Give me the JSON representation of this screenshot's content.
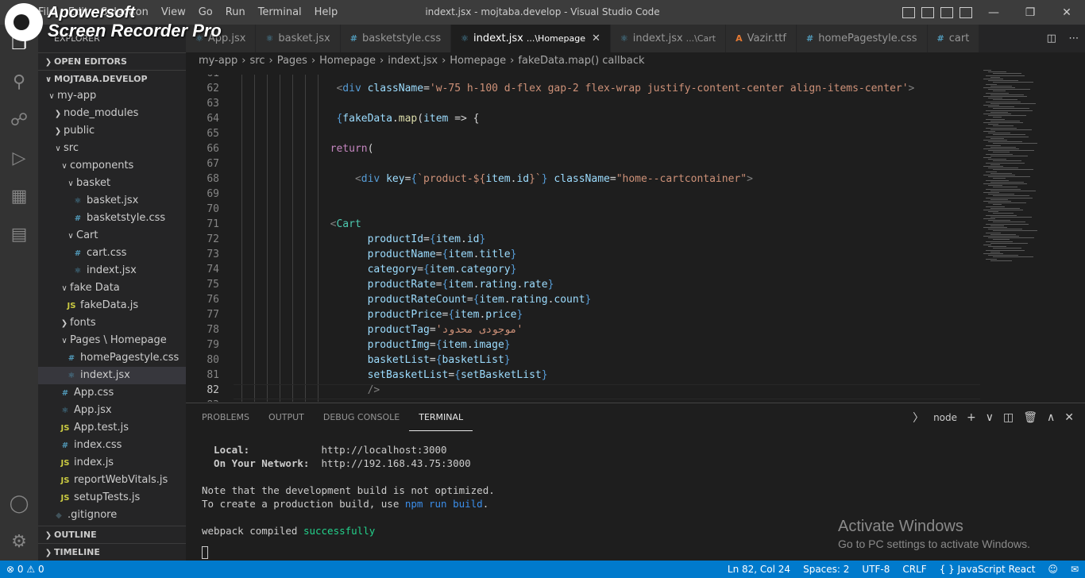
{
  "window": {
    "title": "indext.jsx - mojtaba.develop - Visual Studio Code"
  },
  "menu": [
    "File",
    "Edit",
    "Selection",
    "View",
    "Go",
    "Run",
    "Terminal",
    "Help"
  ],
  "watermark": {
    "line1": "Apowersoft",
    "line2": "Screen Recorder Pro"
  },
  "sidebar": {
    "title": "EXPLORER",
    "open_editors": "OPEN EDITORS",
    "root": "MOJTABA.DEVELOP",
    "items": [
      {
        "label": "my-app",
        "depth": 1,
        "type": "folder-open"
      },
      {
        "label": "node_modules",
        "depth": 2,
        "type": "folder"
      },
      {
        "label": "public",
        "depth": 2,
        "type": "folder"
      },
      {
        "label": "src",
        "depth": 2,
        "type": "folder-open"
      },
      {
        "label": "components",
        "depth": 3,
        "type": "folder-open"
      },
      {
        "label": "basket",
        "depth": 4,
        "type": "folder-open"
      },
      {
        "label": "basket.jsx",
        "depth": 5,
        "type": "react"
      },
      {
        "label": "basketstyle.css",
        "depth": 5,
        "type": "css"
      },
      {
        "label": "Cart",
        "depth": 4,
        "type": "folder-open"
      },
      {
        "label": "cart.css",
        "depth": 5,
        "type": "css"
      },
      {
        "label": "indext.jsx",
        "depth": 5,
        "type": "react"
      },
      {
        "label": "fake Data",
        "depth": 3,
        "type": "folder-open"
      },
      {
        "label": "fakeData.js",
        "depth": 4,
        "type": "js"
      },
      {
        "label": "fonts",
        "depth": 3,
        "type": "folder"
      },
      {
        "label": "Pages \\ Homepage",
        "depth": 3,
        "type": "folder-open"
      },
      {
        "label": "homePagestyle.css",
        "depth": 4,
        "type": "css"
      },
      {
        "label": "indext.jsx",
        "depth": 4,
        "type": "react",
        "selected": true
      },
      {
        "label": "App.css",
        "depth": 3,
        "type": "css"
      },
      {
        "label": "App.jsx",
        "depth": 3,
        "type": "react"
      },
      {
        "label": "App.test.js",
        "depth": 3,
        "type": "js"
      },
      {
        "label": "index.css",
        "depth": 3,
        "type": "css"
      },
      {
        "label": "index.js",
        "depth": 3,
        "type": "js"
      },
      {
        "label": "reportWebVitals.js",
        "depth": 3,
        "type": "js"
      },
      {
        "label": "setupTests.js",
        "depth": 3,
        "type": "js"
      },
      {
        "label": ".gitignore",
        "depth": 2,
        "type": "git"
      }
    ],
    "outline": "OUTLINE",
    "timeline": "TIMELINE"
  },
  "tabs": [
    {
      "label": "App.jsx",
      "icon": "react",
      "hint": ""
    },
    {
      "label": "basket.jsx",
      "icon": "react",
      "hint": ""
    },
    {
      "label": "basketstyle.css",
      "icon": "css",
      "hint": ""
    },
    {
      "label": "indext.jsx",
      "icon": "react",
      "hint": "...\\Homepage",
      "active": true
    },
    {
      "label": "indext.jsx",
      "icon": "react",
      "hint": "...\\Cart"
    },
    {
      "label": "Vazir.ttf",
      "icon": "font",
      "hint": ""
    },
    {
      "label": "homePagestyle.css",
      "icon": "css",
      "hint": ""
    },
    {
      "label": "cart",
      "icon": "css",
      "hint": ""
    }
  ],
  "breadcrumb": [
    "my-app",
    "src",
    "Pages",
    "Homepage",
    "indext.jsx",
    "Homepage",
    "fakeData.map() callback"
  ],
  "code_lines": [
    {
      "n": "61",
      "indent": 0,
      "segs": [
        [
          "",
          "#d4d4d4"
        ]
      ]
    },
    {
      "n": "62",
      "indent": 14,
      "segs": [
        [
          "<",
          "#808080"
        ],
        [
          "div",
          "#569cd6"
        ],
        [
          " ",
          "#d4d4d4"
        ],
        [
          "className",
          "#9cdcfe"
        ],
        [
          "=",
          "#d4d4d4"
        ],
        [
          "'w-75 h-100 d-flex gap-2 flex-wrap justify-content-center align-items-center'",
          "#ce9178"
        ],
        [
          ">",
          "#808080"
        ]
      ]
    },
    {
      "n": "63",
      "indent": 0,
      "segs": [
        [
          "",
          "#d4d4d4"
        ]
      ]
    },
    {
      "n": "64",
      "indent": 14,
      "segs": [
        [
          "{",
          "#569cd6"
        ],
        [
          "fakeData",
          "#9cdcfe"
        ],
        [
          ".",
          "#d4d4d4"
        ],
        [
          "map",
          "#dcdcaa"
        ],
        [
          "(",
          "#d4d4d4"
        ],
        [
          "item",
          "#9cdcfe"
        ],
        [
          " => {",
          "#d4d4d4"
        ]
      ]
    },
    {
      "n": "65",
      "indent": 0,
      "segs": [
        [
          "",
          "#d4d4d4"
        ]
      ]
    },
    {
      "n": "66",
      "indent": 13,
      "segs": [
        [
          "return",
          "#c586c0"
        ],
        [
          "(",
          "#d4d4d4"
        ]
      ]
    },
    {
      "n": "67",
      "indent": 0,
      "segs": [
        [
          "",
          "#d4d4d4"
        ]
      ]
    },
    {
      "n": "68",
      "indent": 17,
      "segs": [
        [
          "<",
          "#808080"
        ],
        [
          "div",
          "#569cd6"
        ],
        [
          " ",
          "#d4d4d4"
        ],
        [
          "key",
          "#9cdcfe"
        ],
        [
          "=",
          "#d4d4d4"
        ],
        [
          "{",
          "#569cd6"
        ],
        [
          "`product-${",
          "#ce9178"
        ],
        [
          "item",
          "#9cdcfe"
        ],
        [
          ".",
          "#d4d4d4"
        ],
        [
          "id",
          "#9cdcfe"
        ],
        [
          "}`",
          "#ce9178"
        ],
        [
          "}",
          "#569cd6"
        ],
        [
          " ",
          "#d4d4d4"
        ],
        [
          "className",
          "#9cdcfe"
        ],
        [
          "=",
          "#d4d4d4"
        ],
        [
          "\"home--cartcontainer\"",
          "#ce9178"
        ],
        [
          ">",
          "#808080"
        ]
      ]
    },
    {
      "n": "69",
      "indent": 0,
      "segs": [
        [
          "",
          "#d4d4d4"
        ]
      ]
    },
    {
      "n": "70",
      "indent": 0,
      "segs": [
        [
          "",
          "#d4d4d4"
        ]
      ]
    },
    {
      "n": "71",
      "indent": 13,
      "segs": [
        [
          "<",
          "#808080"
        ],
        [
          "Cart",
          "#4ec9b0"
        ]
      ]
    },
    {
      "n": "72",
      "indent": 19,
      "segs": [
        [
          "productId",
          "#9cdcfe"
        ],
        [
          "=",
          "#d4d4d4"
        ],
        [
          "{",
          "#569cd6"
        ],
        [
          "item",
          "#9cdcfe"
        ],
        [
          ".",
          "#d4d4d4"
        ],
        [
          "id",
          "#9cdcfe"
        ],
        [
          "}",
          "#569cd6"
        ]
      ]
    },
    {
      "n": "73",
      "indent": 19,
      "segs": [
        [
          "productName",
          "#9cdcfe"
        ],
        [
          "=",
          "#d4d4d4"
        ],
        [
          "{",
          "#569cd6"
        ],
        [
          "item",
          "#9cdcfe"
        ],
        [
          ".",
          "#d4d4d4"
        ],
        [
          "title",
          "#9cdcfe"
        ],
        [
          "}",
          "#569cd6"
        ]
      ]
    },
    {
      "n": "74",
      "indent": 19,
      "segs": [
        [
          "category",
          "#9cdcfe"
        ],
        [
          "=",
          "#d4d4d4"
        ],
        [
          "{",
          "#569cd6"
        ],
        [
          "item",
          "#9cdcfe"
        ],
        [
          ".",
          "#d4d4d4"
        ],
        [
          "category",
          "#9cdcfe"
        ],
        [
          "}",
          "#569cd6"
        ]
      ]
    },
    {
      "n": "75",
      "indent": 19,
      "segs": [
        [
          "productRate",
          "#9cdcfe"
        ],
        [
          "=",
          "#d4d4d4"
        ],
        [
          "{",
          "#569cd6"
        ],
        [
          "item",
          "#9cdcfe"
        ],
        [
          ".",
          "#d4d4d4"
        ],
        [
          "rating",
          "#9cdcfe"
        ],
        [
          ".",
          "#d4d4d4"
        ],
        [
          "rate",
          "#9cdcfe"
        ],
        [
          "}",
          "#569cd6"
        ]
      ]
    },
    {
      "n": "76",
      "indent": 19,
      "segs": [
        [
          "productRateCount",
          "#9cdcfe"
        ],
        [
          "=",
          "#d4d4d4"
        ],
        [
          "{",
          "#569cd6"
        ],
        [
          "item",
          "#9cdcfe"
        ],
        [
          ".",
          "#d4d4d4"
        ],
        [
          "rating",
          "#9cdcfe"
        ],
        [
          ".",
          "#d4d4d4"
        ],
        [
          "count",
          "#9cdcfe"
        ],
        [
          "}",
          "#569cd6"
        ]
      ]
    },
    {
      "n": "77",
      "indent": 19,
      "segs": [
        [
          "productPrice",
          "#9cdcfe"
        ],
        [
          "=",
          "#d4d4d4"
        ],
        [
          "{",
          "#569cd6"
        ],
        [
          "item",
          "#9cdcfe"
        ],
        [
          ".",
          "#d4d4d4"
        ],
        [
          "price",
          "#9cdcfe"
        ],
        [
          "}",
          "#569cd6"
        ]
      ]
    },
    {
      "n": "78",
      "indent": 19,
      "segs": [
        [
          "productTag",
          "#9cdcfe"
        ],
        [
          "=",
          "#d4d4d4"
        ],
        [
          "'موجودی محدود'",
          "#ce9178"
        ]
      ]
    },
    {
      "n": "79",
      "indent": 19,
      "segs": [
        [
          "productImg",
          "#9cdcfe"
        ],
        [
          "=",
          "#d4d4d4"
        ],
        [
          "{",
          "#569cd6"
        ],
        [
          "item",
          "#9cdcfe"
        ],
        [
          ".",
          "#d4d4d4"
        ],
        [
          "image",
          "#9cdcfe"
        ],
        [
          "}",
          "#569cd6"
        ]
      ]
    },
    {
      "n": "80",
      "indent": 19,
      "segs": [
        [
          "basketList",
          "#9cdcfe"
        ],
        [
          "=",
          "#d4d4d4"
        ],
        [
          "{",
          "#569cd6"
        ],
        [
          "basketList",
          "#9cdcfe"
        ],
        [
          "}",
          "#569cd6"
        ]
      ]
    },
    {
      "n": "81",
      "indent": 19,
      "segs": [
        [
          "setBasketList",
          "#9cdcfe"
        ],
        [
          "=",
          "#d4d4d4"
        ],
        [
          "{",
          "#569cd6"
        ],
        [
          "setBasketList",
          "#9cdcfe"
        ],
        [
          "}",
          "#569cd6"
        ]
      ]
    },
    {
      "n": "82",
      "indent": 19,
      "segs": [
        [
          "/>",
          "#808080"
        ]
      ],
      "current": true
    },
    {
      "n": "83",
      "indent": 0,
      "segs": [
        [
          "",
          "#d4d4d4"
        ]
      ]
    }
  ],
  "panel": {
    "tabs": [
      "PROBLEMS",
      "OUTPUT",
      "DEBUG CONSOLE",
      "TERMINAL"
    ],
    "active_tab": "TERMINAL",
    "terminal_name": "node",
    "lines": [
      [
        [
          "  Local:            ",
          "#cccccc",
          true
        ],
        [
          "http://localhost:3000",
          "#cccccc",
          false
        ]
      ],
      [
        [
          "  On Your Network:  ",
          "#cccccc",
          true
        ],
        [
          "http://192.168.43.75:3000",
          "#cccccc",
          false
        ]
      ],
      [
        [
          "",
          "#cccccc",
          false
        ]
      ],
      [
        [
          "Note that the development build is not optimized.",
          "#cccccc",
          false
        ]
      ],
      [
        [
          "To create a production build, use ",
          "#cccccc",
          false
        ],
        [
          "npm run build",
          "#3b8eea",
          false
        ],
        [
          ".",
          "#cccccc",
          false
        ]
      ],
      [
        [
          "",
          "#cccccc",
          false
        ]
      ],
      [
        [
          "webpack compiled ",
          "#cccccc",
          false
        ],
        [
          "successfully",
          "#23d18b",
          false
        ]
      ]
    ]
  },
  "activate_windows": {
    "line1": "Activate Windows",
    "line2": "Go to PC settings to activate Windows."
  },
  "status": {
    "errors": "0",
    "warnings": "0",
    "position": "Ln 82, Col 24",
    "spaces": "Spaces: 2",
    "encoding": "UTF-8",
    "eol": "CRLF",
    "language": "JavaScript React",
    "language_icon": "{ }"
  }
}
